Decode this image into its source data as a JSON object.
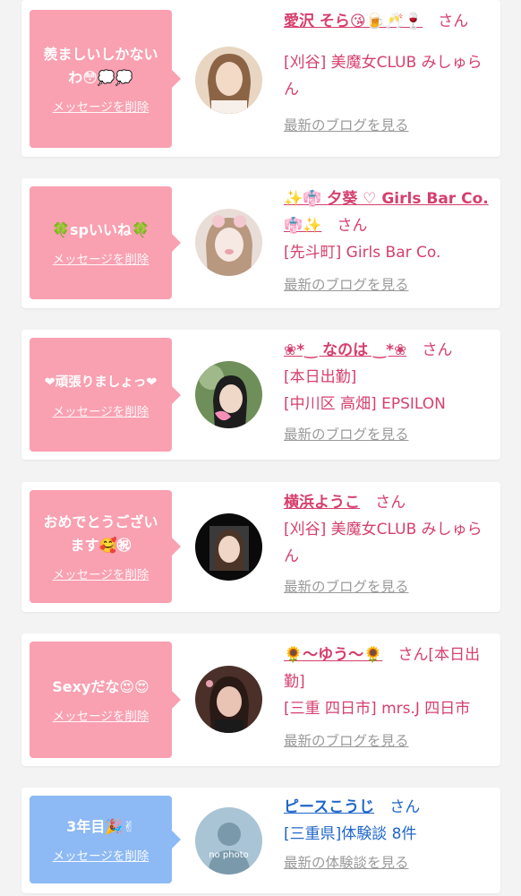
{
  "items": [
    {
      "message": "羨ましいしかないわ😳💭💭",
      "delete_label": "メッセージを削除",
      "name": "愛沢 そら😘🍺🥂🍷",
      "honorific": "さん",
      "lines": [
        "[刈谷] 美魔女CLUB みしゅらん"
      ],
      "link": "最新のブログを見る",
      "color": "#f9a0b1"
    },
    {
      "message": "🍀spいいね🍀",
      "delete_label": "メッセージを削除",
      "name": "✨👘 夕葵 ♡ Girls Bar Co. 👘✨",
      "honorific": "さん",
      "lines": [
        "[先斗町] Girls Bar Co."
      ],
      "link": "最新のブログを見る",
      "color": "#f9a0b1"
    },
    {
      "message": "❤頑張りましょっ❤",
      "delete_label": "メッセージを削除",
      "name": "❀*‿ なのは ‿*❀",
      "honorific": "さん",
      "lines": [
        "[本日出勤]",
        "[中川区 高畑] EPSILON"
      ],
      "link": "最新のブログを見る",
      "color": "#f9a0b1"
    },
    {
      "message": "おめでとうございます🥰㊗",
      "delete_label": "メッセージを削除",
      "name": "横浜ようこ",
      "honorific": "さん",
      "lines": [
        "[刈谷] 美魔女CLUB みしゅらん"
      ],
      "link": "最新のブログを見る",
      "color": "#f9a0b1"
    },
    {
      "message": "Sexyだな😍😍",
      "delete_label": "メッセージを削除",
      "name": "🌻〜ゆう〜🌻",
      "honorific": "さん[本日出勤]",
      "lines": [
        "[三重 四日市] mrs.J 四日市"
      ],
      "link": "最新のブログを見る",
      "color": "#f9a0b1"
    },
    {
      "message": "3年目🎉✌",
      "delete_label": "メッセージを削除",
      "name": "ピースこうじ",
      "honorific": "さん",
      "lines": [
        "[三重県]体験談 8件"
      ],
      "link": "最新の体験談を見る",
      "color": "#8db9f4",
      "avatar_placeholder": "no photo"
    }
  ]
}
